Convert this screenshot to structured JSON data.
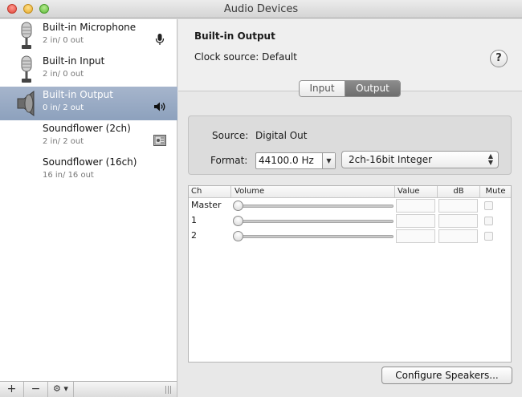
{
  "window": {
    "title": "Audio Devices"
  },
  "devices": [
    {
      "name": "Built-in Microphone",
      "channels": "2 in/ 0 out",
      "icon": "microphone-icon",
      "badge": "microphone-badge-icon"
    },
    {
      "name": "Built-in Input",
      "channels": "2 in/ 0 out",
      "icon": "microphone-icon"
    },
    {
      "name": "Built-in Output",
      "channels": "0 in/ 2 out",
      "icon": "speaker-icon",
      "badge": "speaker-volume-icon",
      "selected": true
    },
    {
      "name": "Soundflower (2ch)",
      "channels": "2 in/ 2 out",
      "badge": "soundflower-badge-icon"
    },
    {
      "name": "Soundflower (16ch)",
      "channels": "16 in/ 16 out"
    }
  ],
  "sidebar_toolbar": {
    "add": "+",
    "remove": "−",
    "gear": "⚙ ▾"
  },
  "detail": {
    "device_title": "Built-in Output",
    "clock_source": "Clock source:  Default",
    "help": "?",
    "tabs": {
      "input": "Input",
      "output": "Output",
      "selected": "output"
    },
    "source_label": "Source:",
    "source_value": "Digital Out",
    "format_label": "Format:",
    "sample_rate": "44100.0 Hz",
    "bit_format": "2ch-16bit Integer"
  },
  "table": {
    "headers": {
      "ch": "Ch",
      "volume": "Volume",
      "value": "Value",
      "db": "dB",
      "mute": "Mute"
    },
    "rows": [
      {
        "ch": "Master",
        "volume": 0
      },
      {
        "ch": "1",
        "volume": 0
      },
      {
        "ch": "2",
        "volume": 0
      }
    ]
  },
  "configure_button": "Configure Speakers..."
}
